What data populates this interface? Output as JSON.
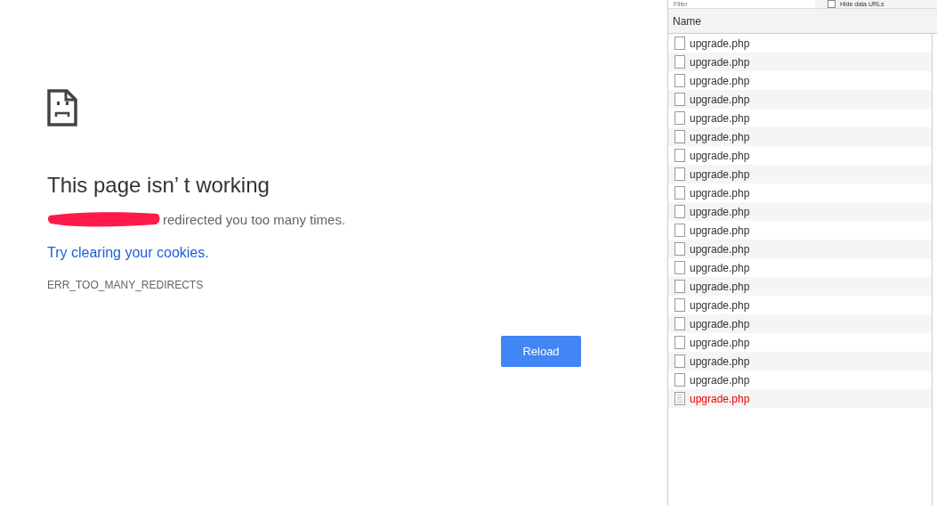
{
  "error_page": {
    "title": "This page isn’ t working",
    "message": "redirected you too many times.",
    "link": "Try clearing your cookies.",
    "code": "ERR_TOO_MANY_REDIRECTS",
    "button": "Reload"
  },
  "devtools": {
    "filter": {
      "placeholder": "Filter"
    },
    "hide_data_urls": {
      "label": "Hide data URLs",
      "checked": false
    },
    "columns": [
      "Name"
    ],
    "rows": [
      {
        "name": "upgrade.php",
        "failed": false
      },
      {
        "name": "upgrade.php",
        "failed": false
      },
      {
        "name": "upgrade.php",
        "failed": false
      },
      {
        "name": "upgrade.php",
        "failed": false
      },
      {
        "name": "upgrade.php",
        "failed": false
      },
      {
        "name": "upgrade.php",
        "failed": false
      },
      {
        "name": "upgrade.php",
        "failed": false
      },
      {
        "name": "upgrade.php",
        "failed": false
      },
      {
        "name": "upgrade.php",
        "failed": false
      },
      {
        "name": "upgrade.php",
        "failed": false
      },
      {
        "name": "upgrade.php",
        "failed": false
      },
      {
        "name": "upgrade.php",
        "failed": false
      },
      {
        "name": "upgrade.php",
        "failed": false
      },
      {
        "name": "upgrade.php",
        "failed": false
      },
      {
        "name": "upgrade.php",
        "failed": false
      },
      {
        "name": "upgrade.php",
        "failed": false
      },
      {
        "name": "upgrade.php",
        "failed": false
      },
      {
        "name": "upgrade.php",
        "failed": false
      },
      {
        "name": "upgrade.php",
        "failed": false
      },
      {
        "name": "upgrade.php",
        "failed": true
      }
    ]
  }
}
